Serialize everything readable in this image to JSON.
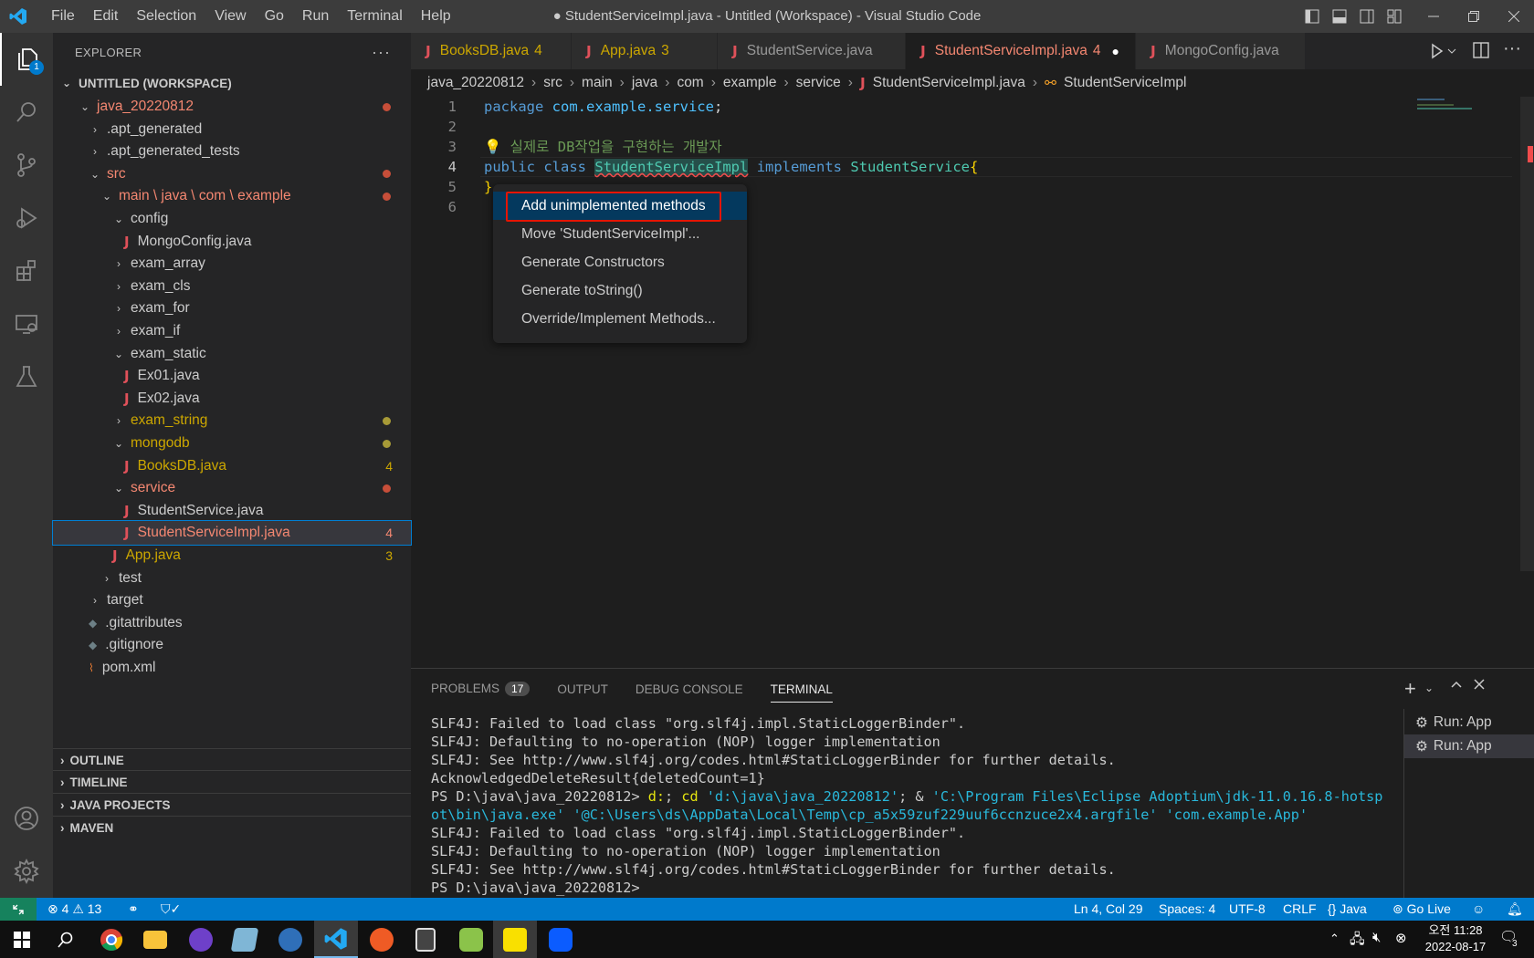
{
  "window": {
    "title": "● StudentServiceImpl.java - Untitled (Workspace) - Visual Studio Code",
    "menu": [
      "File",
      "Edit",
      "Selection",
      "View",
      "Go",
      "Run",
      "Terminal",
      "Help"
    ]
  },
  "activity": {
    "explorer_badge": "1"
  },
  "sidebar": {
    "title": "EXPLORER",
    "more": "···",
    "workspace": "UNTITLED (WORKSPACE)",
    "tree": [
      {
        "label": "java_20220812",
        "chev": "⌄",
        "indent": 0,
        "color": "red",
        "dot": "#c74e39"
      },
      {
        "label": ".apt_generated",
        "chev": "›",
        "indent": 1
      },
      {
        "label": ".apt_generated_tests",
        "chev": "›",
        "indent": 1
      },
      {
        "label": "src",
        "chev": "⌄",
        "indent": 1,
        "color": "red",
        "dot": "#c74e39"
      },
      {
        "label": "main \\ java \\ com \\ example",
        "chev": "⌄",
        "indent": 2,
        "color": "red",
        "dot": "#c74e39"
      },
      {
        "label": "config",
        "chev": "⌄",
        "indent": 3
      },
      {
        "label": "MongoConfig.java",
        "java": true,
        "indent": 4
      },
      {
        "label": "exam_array",
        "chev": "›",
        "indent": 3
      },
      {
        "label": "exam_cls",
        "chev": "›",
        "indent": 3
      },
      {
        "label": "exam_for",
        "chev": "›",
        "indent": 3
      },
      {
        "label": "exam_if",
        "chev": "›",
        "indent": 3
      },
      {
        "label": "exam_static",
        "chev": "⌄",
        "indent": 3
      },
      {
        "label": "Ex01.java",
        "java": true,
        "indent": 4
      },
      {
        "label": "Ex02.java",
        "java": true,
        "indent": 4
      },
      {
        "label": "exam_string",
        "chev": "›",
        "indent": 3,
        "color": "yel",
        "dot": "#a79a37"
      },
      {
        "label": "mongodb",
        "chev": "⌄",
        "indent": 3,
        "color": "yel",
        "dot": "#a79a37"
      },
      {
        "label": "BooksDB.java",
        "java": true,
        "indent": 4,
        "color": "yel",
        "badge": "4"
      },
      {
        "label": "service",
        "chev": "⌄",
        "indent": 3,
        "color": "red",
        "dot": "#c74e39"
      },
      {
        "label": "StudentService.java",
        "java": true,
        "indent": 4
      },
      {
        "label": "StudentServiceImpl.java",
        "java": true,
        "indent": 4,
        "color": "red",
        "badge": "4",
        "selected": true
      },
      {
        "label": "App.java",
        "java": true,
        "indent": 3,
        "color": "yel",
        "badge": "3"
      },
      {
        "label": "test",
        "chev": "›",
        "indent": 2
      },
      {
        "label": "target",
        "chev": "›",
        "indent": 1
      },
      {
        "label": ".gitattributes",
        "icon": "git",
        "indent": 1
      },
      {
        "label": ".gitignore",
        "icon": "git",
        "indent": 1
      },
      {
        "label": "pom.xml",
        "icon": "rss",
        "indent": 1
      }
    ],
    "sections": [
      "OUTLINE",
      "TIMELINE",
      "JAVA PROJECTS",
      "MAVEN"
    ]
  },
  "tabs": [
    {
      "label": "BooksDB.java",
      "badge": "4",
      "color": "yel"
    },
    {
      "label": "App.java",
      "badge": "3",
      "color": "yel"
    },
    {
      "label": "StudentService.java",
      "badge": "",
      "color": "none"
    },
    {
      "label": "StudentServiceImpl.java",
      "badge": "4",
      "color": "red",
      "active": true,
      "dirty": "●"
    },
    {
      "label": "MongoConfig.java",
      "badge": "",
      "color": "none"
    }
  ],
  "breadcrumb": [
    "java_20220812",
    "src",
    "main",
    "java",
    "com",
    "example",
    "service",
    "StudentServiceImpl.java",
    "StudentServiceImpl"
  ],
  "editor": {
    "line_numbers": [
      "1",
      "2",
      "3",
      "4",
      "5",
      "6"
    ],
    "line1_kw": "package",
    "line1_pkg": "com.example.service",
    "line1_end": ";",
    "line3_comment": "실제로 DB작업을 구현하는 개발자",
    "line4_public": "public",
    "line4_class": "class",
    "line4_name": "StudentServiceImpl",
    "line4_impl": "implements",
    "line4_iface": "StudentService",
    "line4_brace": "{",
    "line5": "}"
  },
  "context_menu": [
    "Add unimplemented methods",
    "Move 'StudentServiceImpl'...",
    "Generate Constructors",
    "Generate toString()",
    "Override/Implement Methods..."
  ],
  "panel": {
    "tabs": [
      "PROBLEMS",
      "OUTPUT",
      "DEBUG CONSOLE",
      "TERMINAL"
    ],
    "problems_count": "17",
    "terminal_lines": [
      "SLF4J: Failed to load class \"org.slf4j.impl.StaticLoggerBinder\".",
      "SLF4J: Defaulting to no-operation (NOP) logger implementation",
      "SLF4J: See http://www.slf4j.org/codes.html#StaticLoggerBinder for further details.",
      "AcknowledgedDeleteResult{deletedCount=1}"
    ],
    "prompt": "PS D:\\java\\java_20220812> ",
    "cmd_d": "d:",
    "cmd_semicolon": "; ",
    "cmd_cd": "cd",
    "cmd_path": " 'd:\\java\\java_20220812'",
    "cmd_amp": "; & ",
    "cmd_java1": "'C:\\Program Files\\Eclipse Adoptium\\jdk-11.0.16.8-hotsp",
    "cmd_java2": "ot\\bin\\java.exe' '@C:\\Users\\ds\\AppData\\Local\\Temp\\cp_a5x59zuf229uuf6ccnzuce2x4.argfile' 'com.example.App'",
    "terminal_lines2": [
      "SLF4J: Failed to load class \"org.slf4j.impl.StaticLoggerBinder\".",
      "SLF4J: Defaulting to no-operation (NOP) logger implementation",
      "SLF4J: See http://www.slf4j.org/codes.html#StaticLoggerBinder for further details."
    ],
    "prompt_last": "PS D:\\java\\java_20220812> ",
    "runs": [
      "Run: App",
      "Run: App"
    ]
  },
  "status": {
    "errors": "4",
    "warnings": "13",
    "position": "Ln 4, Col 29",
    "spaces": "Spaces: 4",
    "encoding": "UTF-8",
    "eol": "CRLF",
    "language": "Java",
    "golive": "Go Live"
  },
  "taskbar": {
    "time": "오전 11:28",
    "date": "2022-08-17",
    "notif": "3"
  },
  "colors": {
    "accent": "#007acc",
    "error": "#f48771",
    "warning": "#cca700",
    "highlight_box": "#e51400"
  }
}
